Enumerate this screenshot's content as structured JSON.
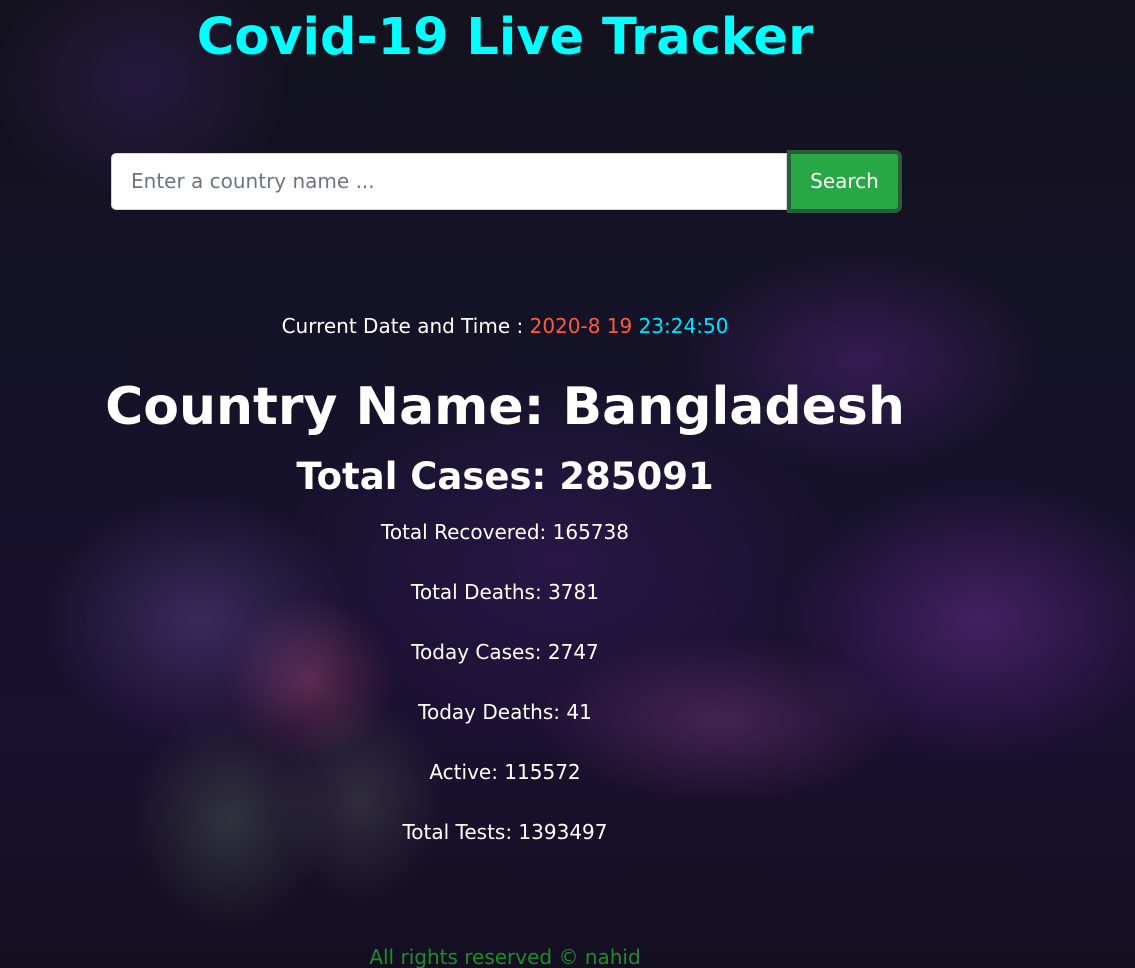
{
  "header": {
    "title": "Covid-19 Live Tracker"
  },
  "search": {
    "placeholder": "Enter a country name ...",
    "value": "",
    "button_label": "Search"
  },
  "datetime": {
    "label": "Current Date and Time :",
    "date": "2020-8 19",
    "time": "23:24:50"
  },
  "country": {
    "text": "Country Name: Bangladesh"
  },
  "stats": {
    "total_cases": "Total Cases: 285091",
    "total_recovered": "Total Recovered: 165738",
    "total_deaths": "Total Deaths: 3781",
    "today_cases": "Today Cases: 2747",
    "today_deaths": "Today Deaths: 41",
    "active": "Active: 115572",
    "total_tests": "Total Tests: 1393497"
  },
  "footer": {
    "text": "All rights reserved © nahid"
  },
  "colors": {
    "title": "#00ffff",
    "date": "#ff5a3c",
    "time": "#00e5ff",
    "search_button": "#28a745",
    "footer": "#1f8c2c"
  }
}
